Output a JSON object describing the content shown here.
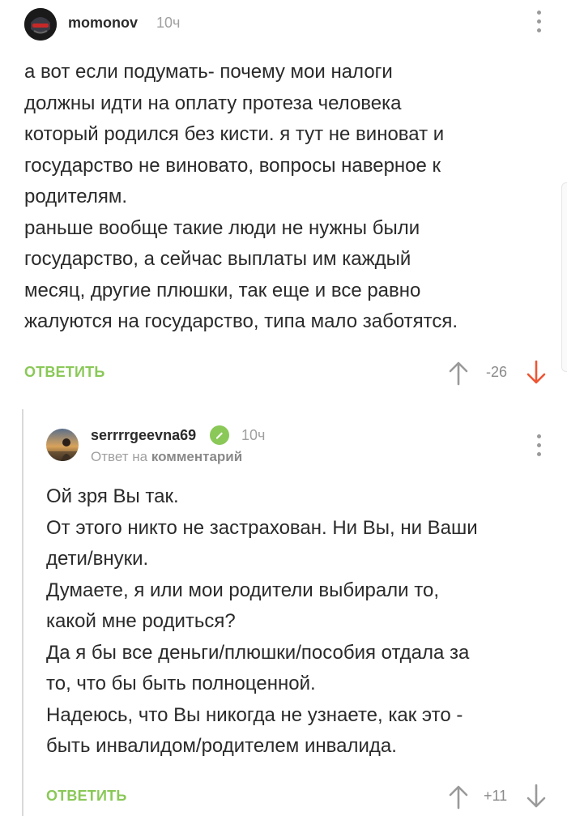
{
  "comments": [
    {
      "username": "momonov",
      "time": "10ч",
      "avatar_icon": "robot-helmet-avatar",
      "lines": [
        "а вот если подумать- почему мои налоги",
        "должны идти на оплату протеза человека",
        "который родился без кисти. я тут не виноват и",
        "государство не виновато, вопросы наверное к",
        "родителям.",
        "раньше вообще такие люди не нужны были",
        "государство, а сейчас выплаты им каждый",
        "месяц, другие плюшки, так еще и все равно",
        "жалуются на государство, типа мало заботятся."
      ],
      "reply_label": "ОТВЕТИТЬ",
      "score": "-26",
      "downvote_active_color": "#ee5533"
    },
    {
      "username": "serrrrgeevna69",
      "time": "10ч",
      "verified": true,
      "reply_prefix": "Ответ на",
      "reply_target": "комментарий",
      "lines": [
        "Ой зря Вы так.",
        "От этого никто не застрахован. Ни Вы, ни Ваши",
        "дети/внуки.",
        "Думаете, я или мои родители выбирали то,",
        "какой мне родиться?",
        "Да я бы все деньги/плюшки/пособия отдала за",
        "то, что бы быть полноценной.",
        "Надеюсь, что Вы никогда не узнаете, как это -",
        "быть инвалидом/родителем инвалида."
      ],
      "reply_label": "ОТВЕТИТЬ",
      "score": "+11"
    }
  ],
  "colors": {
    "accent_green": "#8ac858",
    "muted_gray": "#9a9a9a"
  }
}
